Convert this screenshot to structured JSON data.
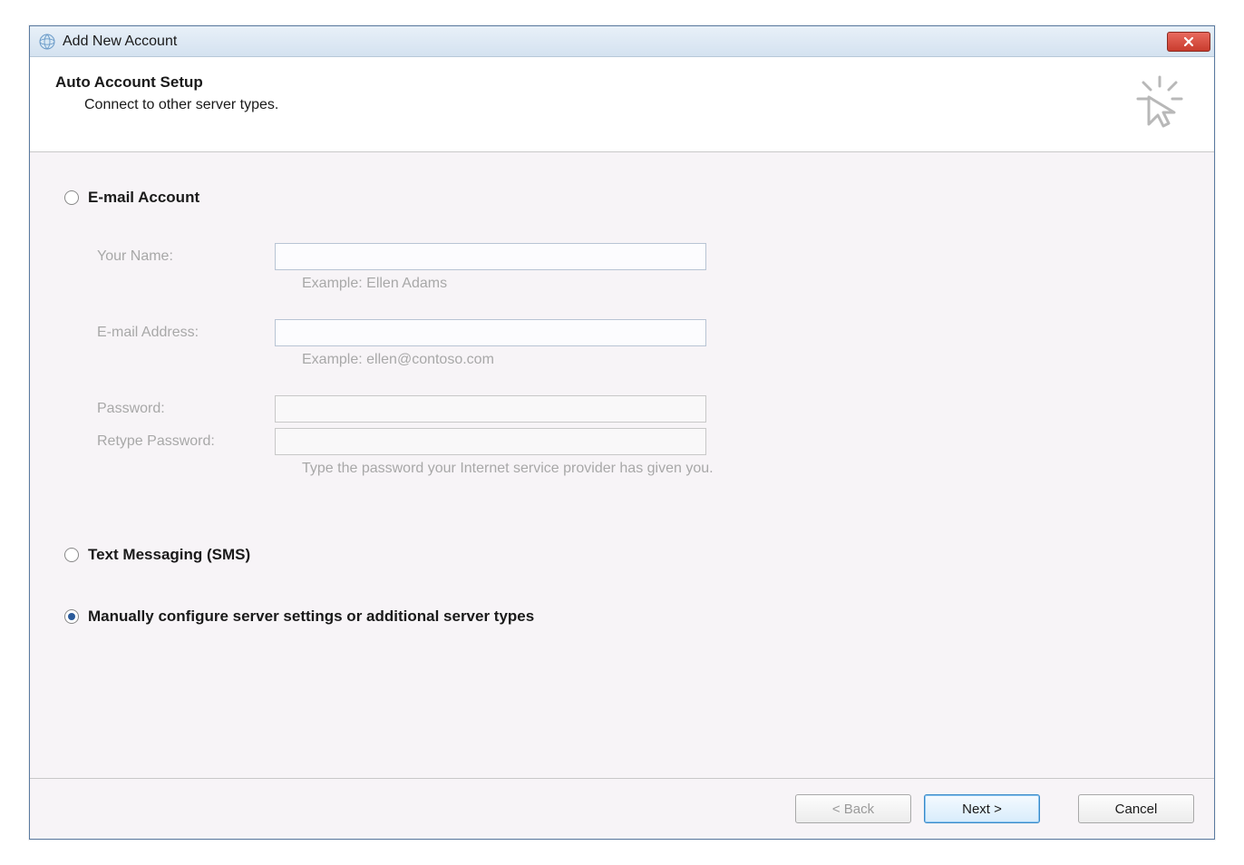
{
  "window": {
    "title": "Add New Account"
  },
  "header": {
    "title": "Auto Account Setup",
    "subtitle": "Connect to other server types."
  },
  "options": {
    "email": {
      "label": "E-mail Account",
      "selected": false
    },
    "sms": {
      "label": "Text Messaging (SMS)",
      "selected": false
    },
    "manual": {
      "label": "Manually configure server settings or additional server types",
      "selected": true
    }
  },
  "form": {
    "name": {
      "label": "Your Name:",
      "value": "",
      "hint": "Example: Ellen Adams"
    },
    "email": {
      "label": "E-mail Address:",
      "value": "",
      "hint": "Example: ellen@contoso.com"
    },
    "password": {
      "label": "Password:",
      "value": ""
    },
    "retype": {
      "label": "Retype Password:",
      "value": "",
      "hint": "Type the password your Internet service provider has given you."
    }
  },
  "footer": {
    "back": "< Back",
    "next": "Next >",
    "cancel": "Cancel"
  }
}
